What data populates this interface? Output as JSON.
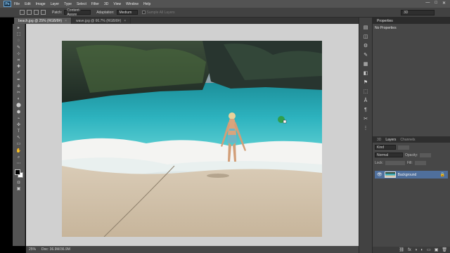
{
  "app": {
    "logo": "Ps"
  },
  "menu": [
    "File",
    "Edit",
    "Image",
    "Layer",
    "Type",
    "Select",
    "Filter",
    "3D",
    "View",
    "Window",
    "Help"
  ],
  "window_controls": {
    "minimize": "—",
    "maximize": "□",
    "close": "✕"
  },
  "options": {
    "patch_label": "Patch:",
    "patch_value": "Content-Aware",
    "adaptation_label": "Adaptation:",
    "adaptation_value": "Medium",
    "sample_all_layers": "Sample All Layers"
  },
  "workspace": "3D",
  "tabs": [
    {
      "label": "beach.jpg @ 25% (RGB/8#)",
      "close": "×"
    },
    {
      "label": "wave.jpg @ 66.7% (RGB/8#)",
      "close": "×"
    }
  ],
  "status": {
    "zoom": "25%",
    "doc": "Doc: 36.9M/36.9M"
  },
  "panels": {
    "properties_tab": "Properties",
    "properties_msg": "No Properties",
    "layers_tab_3d": "3D",
    "layers_tab": "Layers",
    "channels_tab": "Channels",
    "kind": "Kind",
    "blend_mode": "Normal",
    "opacity": "Opacity:",
    "lock": "Lock:",
    "fill": "Fill:",
    "layer_name": "Background"
  },
  "tools": [
    "▸",
    "⬚",
    "◌",
    "✎",
    "⊹",
    "⌗",
    "✚",
    "✐",
    "✒",
    "⎈",
    "✂",
    "◐",
    "⬤",
    "⬢",
    "⌁",
    "✜",
    "T",
    "↖",
    "▭",
    "✋",
    "⌕",
    "⋯"
  ],
  "sidebar_icons": [
    "▤",
    "◫",
    "⚙",
    "✎",
    "▦",
    "◧",
    "⚑",
    "⬚",
    "Å",
    "¶",
    "✂",
    "⋮"
  ],
  "layer_footer_icons": [
    "⛓",
    "fx",
    "◑",
    "◐",
    "▭",
    "▣",
    "🗑"
  ],
  "colors": {
    "foreground": "#000000",
    "background": "#ffffff",
    "selection": "#4f6f9c"
  }
}
